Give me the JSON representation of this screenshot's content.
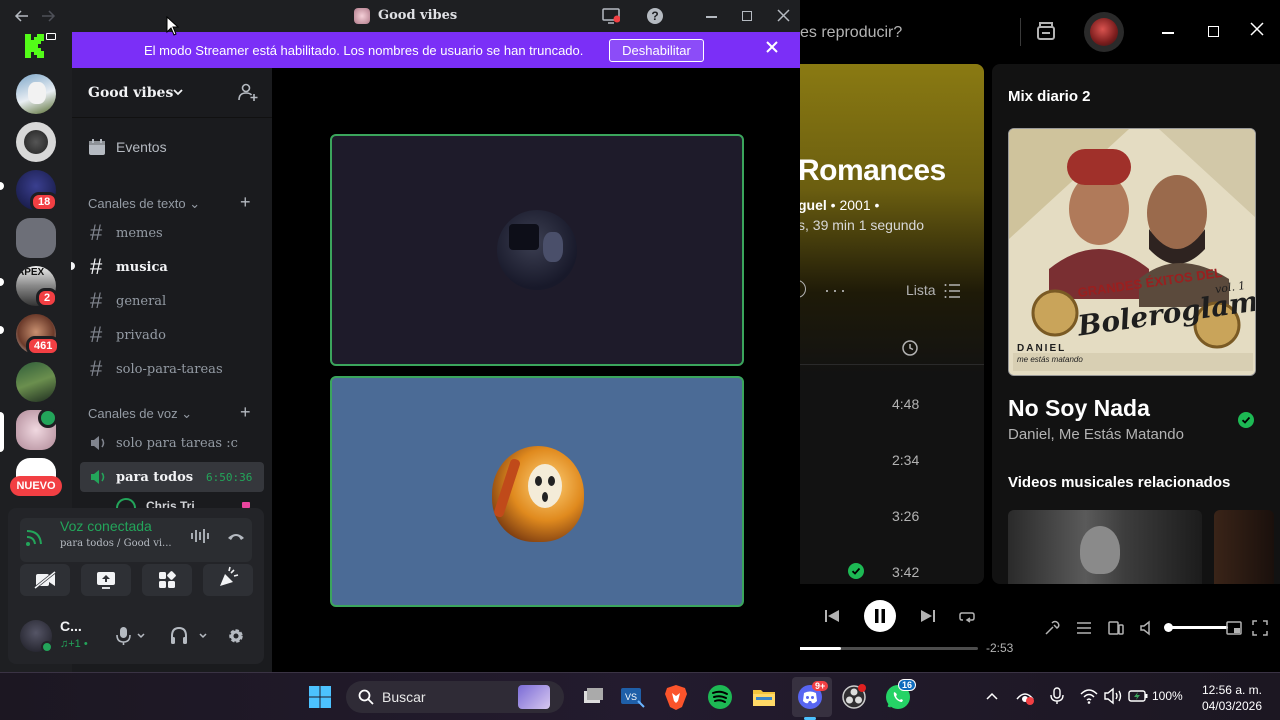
{
  "spotify": {
    "search_text": "es reproducir?",
    "album": {
      "title": "Romances",
      "meta_artist": "guel",
      "meta_year": "• 2001 •",
      "duration": "s, 39 min 1 segundo",
      "more": "···",
      "lista_label": "Lista"
    },
    "tracks": [
      {
        "duration": "4:48"
      },
      {
        "duration": "2:34"
      },
      {
        "duration": "3:26"
      },
      {
        "duration": "3:42"
      }
    ],
    "now_playing_panel": {
      "mix_title": "Mix diario 2",
      "cover_text_top": "GRANDES ÉXITOS DEL",
      "cover_text_main": "Boleroglam",
      "cover_text_vol": "vol. 1",
      "cover_artist": "DANIEL",
      "cover_artist_sub": "me estás matando",
      "song_title": "No Soy Nada",
      "song_artist": "Daniel, Me Estás Matando",
      "videos_title": "Videos musicales relacionados"
    },
    "player": {
      "remaining": "-2:53",
      "progress": 0.24,
      "volume": 1.0
    }
  },
  "discord": {
    "window_title": "Good vibes",
    "streamer_notice": "El modo Streamer está habilitado. Los nombres de usuario se han truncado.",
    "streamer_button": "Deshabilitar",
    "server_name": "Good vibes",
    "events_label": "Eventos",
    "text_category": "Canales de texto",
    "text_channels": [
      {
        "name": "memes"
      },
      {
        "name": "musica"
      },
      {
        "name": "general"
      },
      {
        "name": "privado"
      },
      {
        "name": "solo-para-tareas"
      }
    ],
    "voice_category": "Canales de voz",
    "voice_channels": [
      {
        "name": "solo para tareas :c"
      },
      {
        "name": "para todos",
        "timer": "6:50:36"
      }
    ],
    "voice_member_partial": "Chris Tri...",
    "server_badges": [
      "18",
      "2",
      "461"
    ],
    "new_label": "NUEVO",
    "voice_status": {
      "title": "Voz conectada",
      "subtitle": "para todos / Good vi..."
    },
    "user": {
      "name": "C...",
      "activity": "♫+1 •"
    }
  },
  "taskbar": {
    "search_placeholder": "Buscar",
    "discord_badge": "9+",
    "whatsapp_badge": "16",
    "battery": "100%",
    "time": "12:56 a. m.",
    "date": "04/03/2026"
  },
  "colors": {
    "spotify_green": "#1db954",
    "discord_blurple": "#5865f2",
    "streamer_bar": "#7b2ff7",
    "voice_green": "#23a55a",
    "badge_red": "#f23f43"
  }
}
